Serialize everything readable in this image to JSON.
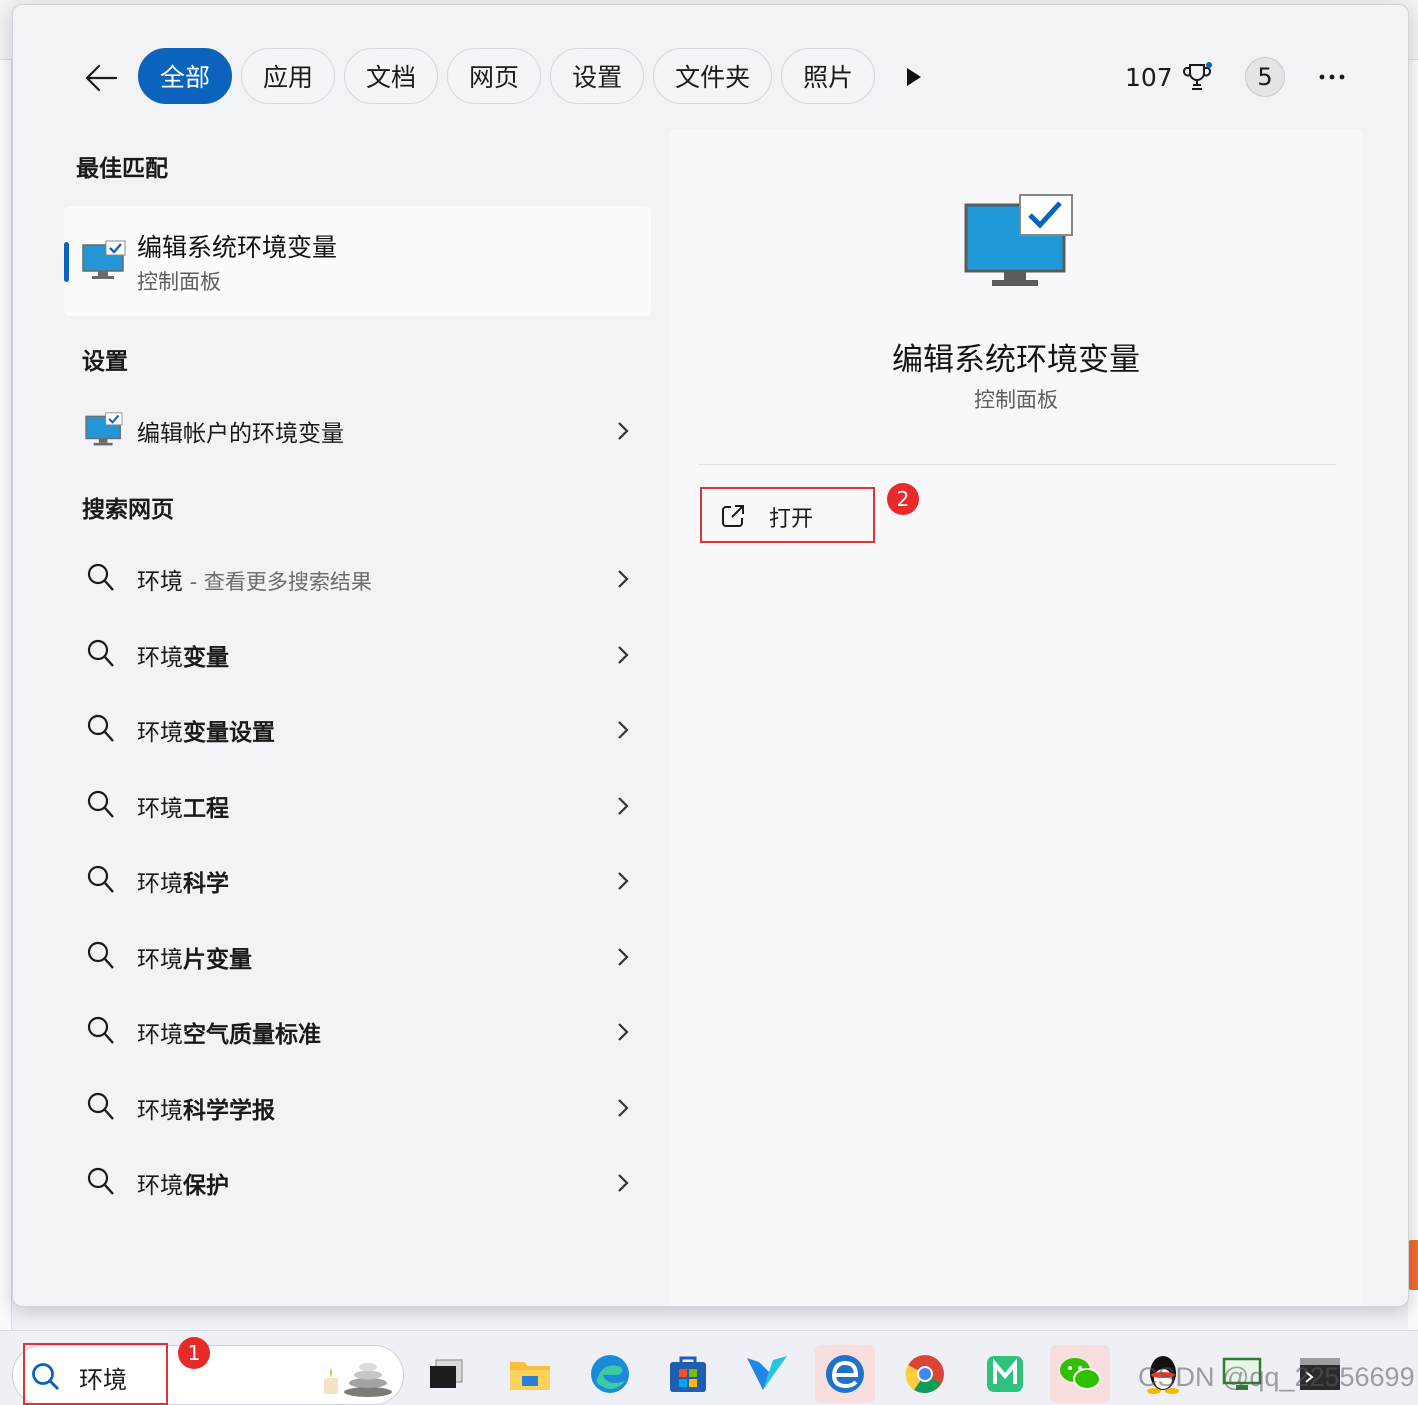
{
  "tabs": [
    {
      "label": "全部",
      "active": true
    },
    {
      "label": "应用",
      "active": false
    },
    {
      "label": "文档",
      "active": false
    },
    {
      "label": "网页",
      "active": false
    },
    {
      "label": "设置",
      "active": false
    },
    {
      "label": "文件夹",
      "active": false
    },
    {
      "label": "照片",
      "active": false
    }
  ],
  "header": {
    "points": "107",
    "notifications": "5"
  },
  "best_match": {
    "section": "最佳匹配",
    "title": "编辑系统环境变量",
    "subtitle": "控制面板"
  },
  "settings": {
    "section": "设置",
    "item": "编辑帐户的环境变量"
  },
  "web": {
    "section": "搜索网页",
    "first": {
      "query": "环境",
      "suffix": " - 查看更多搜索结果"
    },
    "suggestions": [
      {
        "prefix": "环境",
        "bold": "变量"
      },
      {
        "prefix": "环境",
        "bold": "变量设置"
      },
      {
        "prefix": "环境",
        "bold": "工程"
      },
      {
        "prefix": "环境",
        "bold": "科学"
      },
      {
        "prefix": "环境",
        "bold": "片变量"
      },
      {
        "prefix": "环境",
        "bold": "空气质量标准"
      },
      {
        "prefix": "环境",
        "bold": "科学学报"
      },
      {
        "prefix": "环境",
        "bold": "保护"
      }
    ]
  },
  "preview": {
    "title": "编辑系统环境变量",
    "subtitle": "控制面板",
    "open_label": "打开"
  },
  "markers": {
    "one": "1",
    "two": "2"
  },
  "taskbar": {
    "search_value": "环境",
    "watermark": "CSDN @qq_22556699",
    "apps": [
      "task-view-icon",
      "file-explorer-icon",
      "edge-icon",
      "microsoft-store-icon",
      "vcode-app-icon",
      "ie-edge-icon",
      "chrome-icon",
      "mobaxterm-icon",
      "wechat-icon",
      "qq-icon",
      "remote-desktop-icon",
      "terminal-icon"
    ]
  },
  "colors": {
    "accent": "#0b63be",
    "highlight": "#e03434"
  }
}
